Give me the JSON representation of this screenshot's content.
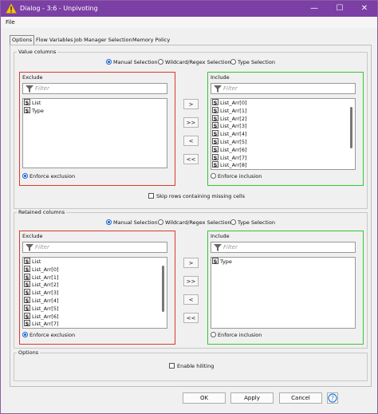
{
  "window": {
    "title": "Dialog - 3:6 - Unpivoting",
    "minimize": "—",
    "maximize": "☐",
    "close": "✕"
  },
  "menu": {
    "file": "File"
  },
  "tabs": [
    {
      "label": "Options"
    },
    {
      "label": "Flow Variables"
    },
    {
      "label": "Job Manager Selection"
    },
    {
      "label": "Memory Policy"
    }
  ],
  "value_columns": {
    "title": "Value columns",
    "modes": [
      "Manual Selection",
      "Wildcard/Regex Selection",
      "Type Selection"
    ],
    "selected_mode": "Manual Selection",
    "exclude": {
      "label": "Exclude",
      "filter_placeholder": "Filter",
      "items": [
        "List",
        "Type"
      ],
      "enforce": "Enforce exclusion",
      "enforce_selected": true
    },
    "include": {
      "label": "Include",
      "filter_placeholder": "Filter",
      "items": [
        "List_Arr[0]",
        "List_Arr[1]",
        "List_Arr[2]",
        "List_Arr[3]",
        "List_Arr[4]",
        "List_Arr[5]",
        "List_Arr[6]",
        "List_Arr[7]",
        "List_Arr[8]"
      ],
      "enforce": "Enforce inclusion",
      "enforce_selected": false
    },
    "skip_missing": "Skip rows containing missing cells"
  },
  "retained_columns": {
    "title": "Retained columns",
    "modes": [
      "Manual Selection",
      "Wildcard/Regex Selection",
      "Type Selection"
    ],
    "selected_mode": "Manual Selection",
    "exclude": {
      "label": "Exclude",
      "filter_placeholder": "Filter",
      "items": [
        "List",
        "List_Arr[0]",
        "List_Arr[1]",
        "List_Arr[2]",
        "List_Arr[3]",
        "List_Arr[4]",
        "List_Arr[5]",
        "List_Arr[6]",
        "List_Arr[7]"
      ],
      "enforce": "Enforce exclusion",
      "enforce_selected": true
    },
    "include": {
      "label": "Include",
      "filter_placeholder": "Filter",
      "items": [
        "Type"
      ],
      "enforce": "Enforce inclusion",
      "enforce_selected": false
    }
  },
  "arrows": {
    "add": ">",
    "add_all": ">>",
    "remove": "<",
    "remove_all": "<<"
  },
  "type_icon": "S",
  "options": {
    "title": "Options",
    "enable_hiliting": "Enable hiliting"
  },
  "buttons": {
    "ok": "OK",
    "apply": "Apply",
    "cancel": "Cancel"
  },
  "colors": {
    "titlebar": "#7b3fa5",
    "exclude_border": "#d93a2b",
    "include_border": "#32c832",
    "radio_selected": "#1a62d0"
  }
}
